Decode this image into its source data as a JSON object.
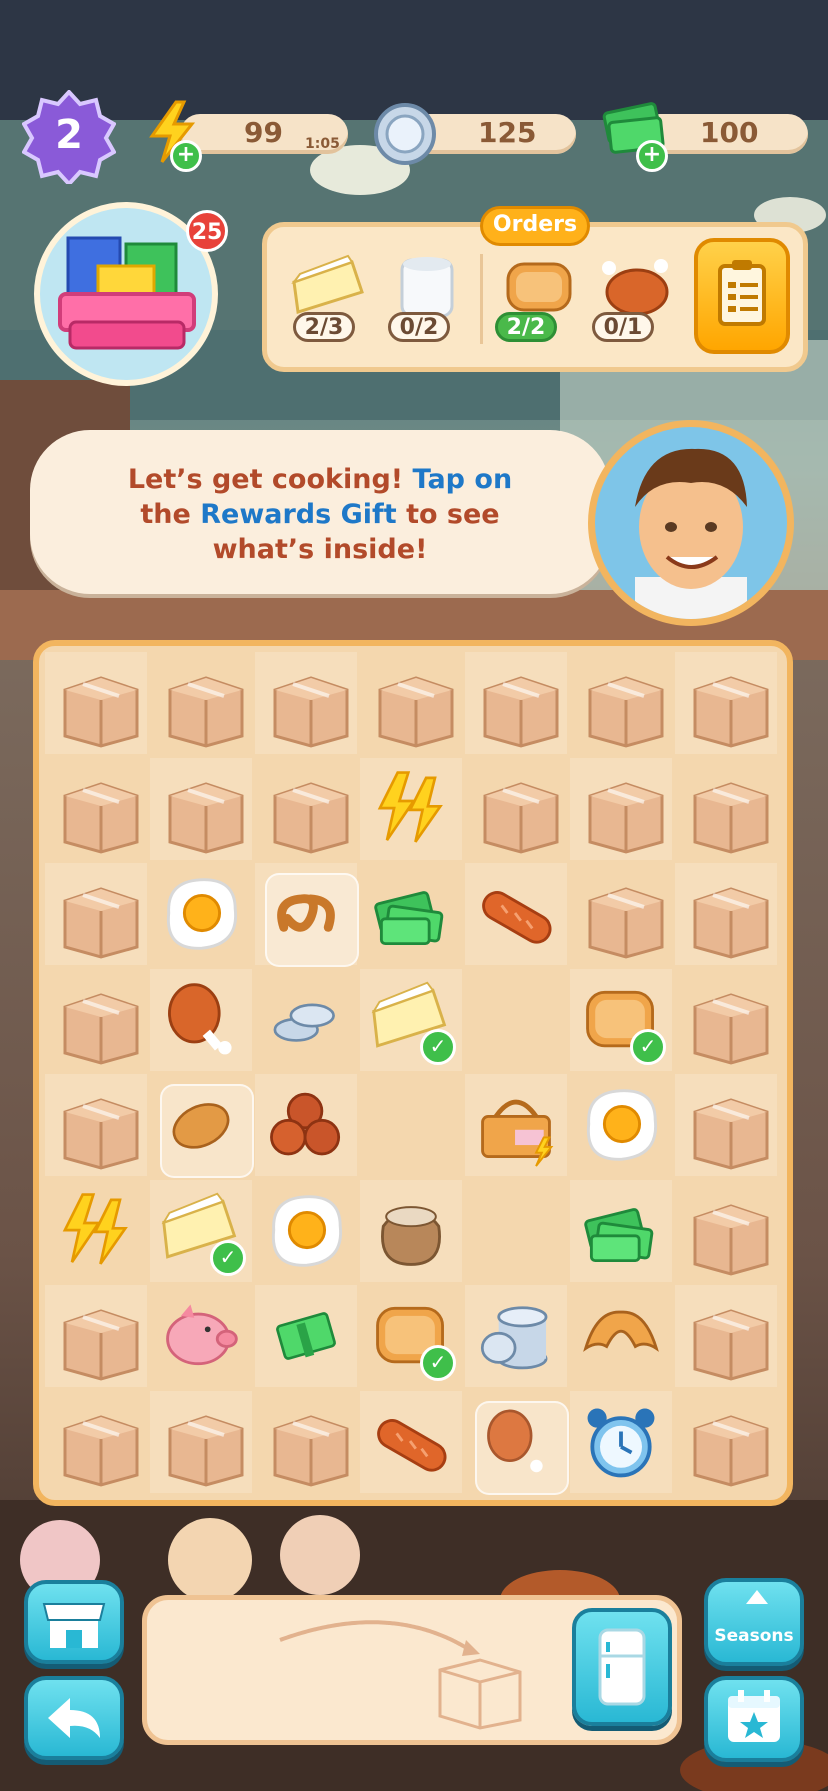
{
  "hud": {
    "level": "2",
    "energy": "99",
    "energy_timer": "1:05",
    "coins": "125",
    "cash": "100",
    "gift_count": "25"
  },
  "orders": {
    "title": "Orders",
    "items": [
      {
        "name": "cheese-icon",
        "count": "2/3",
        "done": false
      },
      {
        "name": "milk-icon",
        "count": "0/2",
        "done": false
      },
      {
        "name": "toast-icon",
        "count": "2/2",
        "done": true
      },
      {
        "name": "roast-chicken-icon",
        "count": "0/1",
        "done": false
      }
    ]
  },
  "dialog": {
    "line1_a": "Let’s get cooking!",
    "line1_b": " Tap on",
    "line2_a": "the ",
    "line2_b": "Rewards Gift",
    "line2_c": " to see",
    "line3": "what’s inside!"
  },
  "board": {
    "rows": [
      [
        "box",
        "box",
        "box",
        "box",
        "box",
        "box",
        "box"
      ],
      [
        "box",
        "box",
        "box",
        "energy-icon",
        "box",
        "box",
        "box"
      ],
      [
        "box",
        "fried-egg-icon",
        "pretzel-bubble-icon",
        "cash-stack-icon",
        "sausage-icon",
        "box",
        "box"
      ],
      [
        "box",
        "chicken-leg-icon",
        "coins-icon",
        "cheese-icon-check",
        "empty",
        "toast-icon-check",
        "box"
      ],
      [
        "box",
        "bread-bubble-icon",
        "meatballs-icon",
        "empty",
        "picnic-basket-icon",
        "fried-egg-icon",
        "box"
      ],
      [
        "energy-icon",
        "cheese-icon-check",
        "fried-egg-icon",
        "flour-sack-icon",
        "empty",
        "cash-stack-icon",
        "box"
      ],
      [
        "box",
        "piggy-bank-icon",
        "cash-icon",
        "toast-icon-check",
        "coins-stack-icon",
        "croissant-icon",
        "box"
      ],
      [
        "box",
        "box",
        "box",
        "sausage-icon",
        "chicken-leg-bubble-icon",
        "alarm-clock-icon",
        "box"
      ]
    ]
  },
  "buttons": {
    "seasons_label": "Seasons"
  },
  "colors": {
    "accent": "#f2b55f",
    "teal": "#29b8d4",
    "dialog_red": "#b24a2a",
    "dialog_blue": "#1e78c8"
  }
}
